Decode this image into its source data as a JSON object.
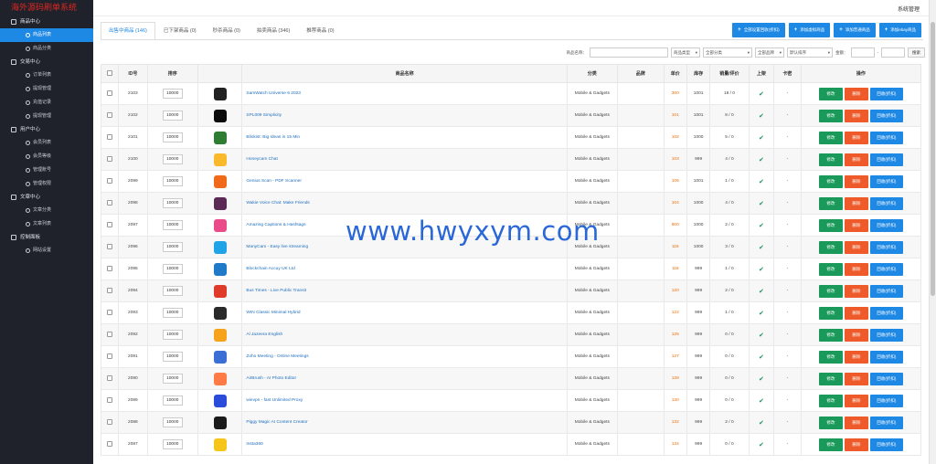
{
  "app": {
    "title": "海外源码刷单系统",
    "version": ""
  },
  "topbar": {
    "system_admin": "系统管理"
  },
  "sidebar": {
    "groups": [
      {
        "title": "商品中心",
        "items": [
          {
            "label": "商品列表",
            "active": true
          },
          {
            "label": "商品分类",
            "active": false
          }
        ]
      },
      {
        "title": "交易中心",
        "items": [
          {
            "label": "订单列表"
          },
          {
            "label": "提现管理"
          },
          {
            "label": "充值记录"
          },
          {
            "label": "提现管理"
          }
        ]
      },
      {
        "title": "用户中心",
        "items": [
          {
            "label": "会员列表"
          },
          {
            "label": "会员等级"
          },
          {
            "label": "管理账号"
          },
          {
            "label": "管理权限"
          }
        ]
      },
      {
        "title": "文章中心",
        "items": [
          {
            "label": "文章分类"
          },
          {
            "label": "文章列表"
          }
        ]
      },
      {
        "title": "控制面板",
        "items": [
          {
            "label": "网站设置"
          }
        ]
      }
    ]
  },
  "tabs": [
    {
      "label": "出售中商品 (146)",
      "active": true
    },
    {
      "label": "已下架商品 (0)"
    },
    {
      "label": "秒杀商品 (0)"
    },
    {
      "label": "拍卖商品 (346)"
    },
    {
      "label": "推荐商品 (0)"
    }
  ],
  "actions": [
    {
      "label": "全部设置回收(折扣)"
    },
    {
      "label": "添加虚拟商品"
    },
    {
      "label": "添加普通商品"
    },
    {
      "label": "添加ebay商品"
    }
  ],
  "filters": {
    "name_label": "商品名称：",
    "name_value": "",
    "type_select": "商品类型",
    "category_select": "全部分类",
    "brand_select": "全部品牌",
    "sort_select": "默认排序",
    "amount_label": "金额：",
    "amount_sep": "-",
    "search_button": "搜索"
  },
  "table": {
    "columns": [
      "",
      "ID号",
      "排序",
      "",
      "商品名称",
      "分类",
      "品牌",
      "单价",
      "库存",
      "销量/评价",
      "上架",
      "卡密",
      "操作"
    ],
    "op_labels": {
      "edit": "修改",
      "delete": "删除",
      "recycle": "回收(折扣)"
    },
    "rows": [
      {
        "id": "2103",
        "weight": "10000",
        "icon_color": "#222222",
        "name": "SamWatch Universe 6 2023",
        "category": "Mobile & Gadgets",
        "brand": "",
        "price": "300",
        "stock": "1001",
        "sales": "18 / 0",
        "onshelf": "✔",
        "card": "-"
      },
      {
        "id": "2102",
        "weight": "10000",
        "icon_color": "#0b0b0b",
        "name": "SPL009 Simplicity",
        "category": "Mobile & Gadgets",
        "brand": "",
        "price": "101",
        "stock": "1001",
        "sales": "8 / 0",
        "onshelf": "✔",
        "card": "-"
      },
      {
        "id": "2101",
        "weight": "10000",
        "icon_color": "#2e7d32",
        "name": "Blinkist: Big Ideas in 15 Min",
        "category": "Mobile & Gadgets",
        "brand": "",
        "price": "102",
        "stock": "1000",
        "sales": "5 / 0",
        "onshelf": "✔",
        "card": "-"
      },
      {
        "id": "2100",
        "weight": "10000",
        "icon_color": "#f9b92a",
        "name": "Honeycam Chat",
        "category": "Mobile & Gadgets",
        "brand": "",
        "price": "103",
        "stock": "999",
        "sales": "4 / 0",
        "onshelf": "✔",
        "card": "-"
      },
      {
        "id": "2099",
        "weight": "10000",
        "icon_color": "#f06a1a",
        "name": "Genius Scan - PDF Scanner",
        "category": "Mobile & Gadgets",
        "brand": "",
        "price": "106",
        "stock": "1001",
        "sales": "1 / 0",
        "onshelf": "✔",
        "card": "-"
      },
      {
        "id": "2098",
        "weight": "10000",
        "icon_color": "#5b2a55",
        "name": "Wakie Voice Chat: Make Friends",
        "category": "Mobile & Gadgets",
        "brand": "",
        "price": "104",
        "stock": "1000",
        "sales": "4 / 0",
        "onshelf": "✔",
        "card": "-"
      },
      {
        "id": "2097",
        "weight": "10000",
        "icon_color": "#ea4c89",
        "name": "Amazing Captions & Hashtags",
        "category": "Mobile & Gadgets",
        "brand": "",
        "price": "800",
        "stock": "1000",
        "sales": "2 / 0",
        "onshelf": "✔",
        "card": "-"
      },
      {
        "id": "2096",
        "weight": "10000",
        "icon_color": "#20a4e8",
        "name": "ManyCam - Easy live streaming",
        "category": "Mobile & Gadgets",
        "brand": "",
        "price": "115",
        "stock": "1000",
        "sales": "3 / 0",
        "onshelf": "✔",
        "card": "-"
      },
      {
        "id": "2095",
        "weight": "10000",
        "icon_color": "#1f7ac9",
        "name": "Blockchain Accuy UK Ltd",
        "category": "Mobile & Gadgets",
        "brand": "",
        "price": "118",
        "stock": "999",
        "sales": "1 / 0",
        "onshelf": "✔",
        "card": "-"
      },
      {
        "id": "2094",
        "weight": "10000",
        "icon_color": "#e03b2a",
        "name": "Bus Times - Live Public Transit",
        "category": "Mobile & Gadgets",
        "brand": "",
        "price": "120",
        "stock": "999",
        "sales": "2 / 0",
        "onshelf": "✔",
        "card": "-"
      },
      {
        "id": "2093",
        "weight": "10000",
        "icon_color": "#2a2a2a",
        "name": "WIN Classic Minimal Hybrid",
        "category": "Mobile & Gadgets",
        "brand": "",
        "price": "122",
        "stock": "999",
        "sales": "1 / 0",
        "onshelf": "✔",
        "card": "-"
      },
      {
        "id": "2092",
        "weight": "10000",
        "icon_color": "#f7a21b",
        "name": "Al Jazeera English",
        "category": "Mobile & Gadgets",
        "brand": "",
        "price": "125",
        "stock": "999",
        "sales": "0 / 0",
        "onshelf": "✔",
        "card": "-"
      },
      {
        "id": "2091",
        "weight": "10000",
        "icon_color": "#3b6fd6",
        "name": "Zoho Meeting - Online Meetings",
        "category": "Mobile & Gadgets",
        "brand": "",
        "price": "127",
        "stock": "999",
        "sales": "0 / 0",
        "onshelf": "✔",
        "card": "-"
      },
      {
        "id": "2090",
        "weight": "10000",
        "icon_color": "#ff7a45",
        "name": "AirBrush - AI Photo Editor",
        "category": "Mobile & Gadgets",
        "brand": "",
        "price": "128",
        "stock": "999",
        "sales": "0 / 0",
        "onshelf": "✔",
        "card": "-"
      },
      {
        "id": "2089",
        "weight": "10000",
        "icon_color": "#2b4cdb",
        "name": "wievpn - fast Unlimited Proxy",
        "category": "Mobile & Gadgets",
        "brand": "",
        "price": "130",
        "stock": "999",
        "sales": "0 / 0",
        "onshelf": "✔",
        "card": "-"
      },
      {
        "id": "2088",
        "weight": "10000",
        "icon_color": "#1b1b1b",
        "name": "Piggy Magic AI Content Creator",
        "category": "Mobile & Gadgets",
        "brand": "",
        "price": "132",
        "stock": "999",
        "sales": "2 / 0",
        "onshelf": "✔",
        "card": "-"
      },
      {
        "id": "2087",
        "weight": "10000",
        "icon_color": "#f5c518",
        "name": "Insta360",
        "category": "Mobile & Gadgets",
        "brand": "",
        "price": "134",
        "stock": "999",
        "sales": "0 / 0",
        "onshelf": "✔",
        "card": "-"
      }
    ]
  },
  "watermark": "www.hwyxym.com"
}
